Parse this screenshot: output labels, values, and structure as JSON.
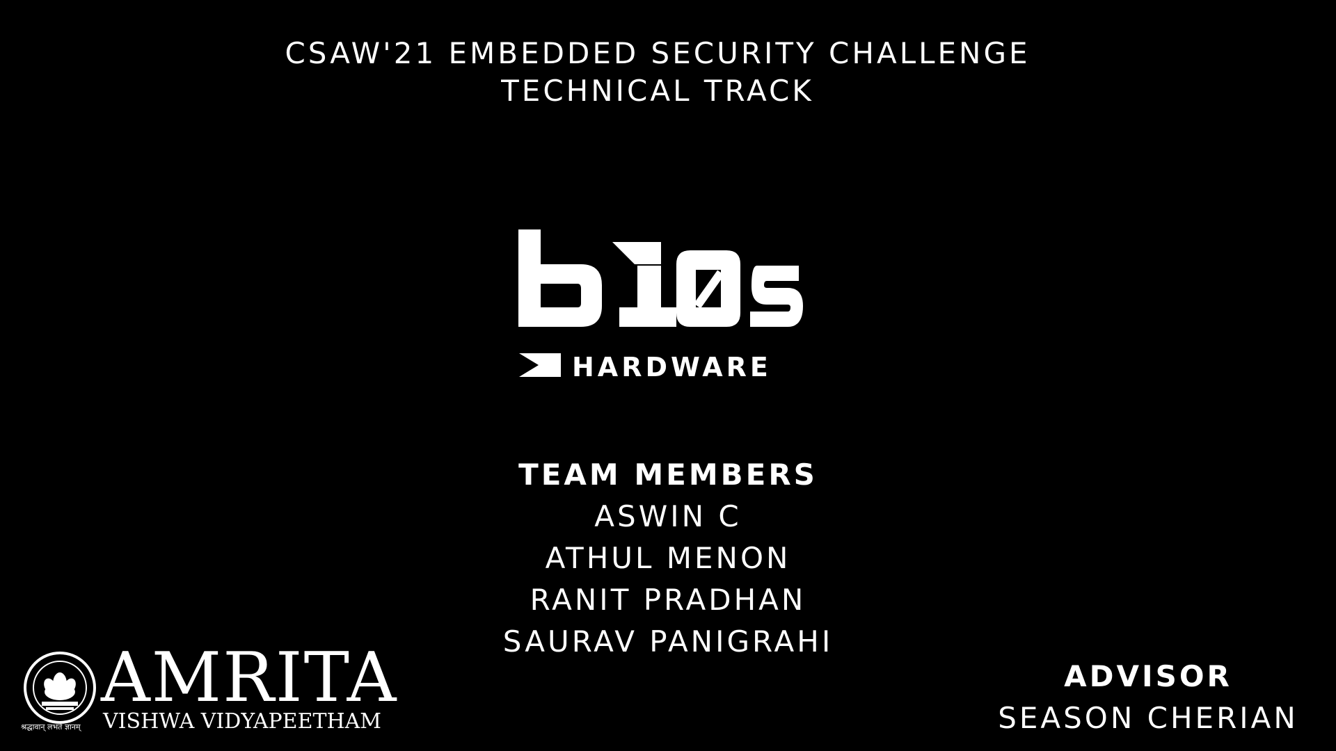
{
  "header": {
    "line1": "CSAW'21 EMBEDDED SECURITY CHALLENGE",
    "line2": "TECHNICAL TRACK"
  },
  "logo": {
    "name": "b10s",
    "tagline": "HARDWARE"
  },
  "team": {
    "heading": "TEAM MEMBERS",
    "members": [
      "ASWIN C",
      "ATHUL MENON",
      "RANIT PRADHAN",
      "SAURAV PANIGRAHI"
    ]
  },
  "advisor": {
    "heading": "ADVISOR",
    "name": "SEASON CHERIAN"
  },
  "institution": {
    "name": "AMRITA",
    "subtitle": "VISHWA VIDYAPEETHAM",
    "motto": "श्रद्धावान् लभते ज्ञानम्"
  },
  "colors": {
    "background": "#000000",
    "text": "#ffffff"
  }
}
